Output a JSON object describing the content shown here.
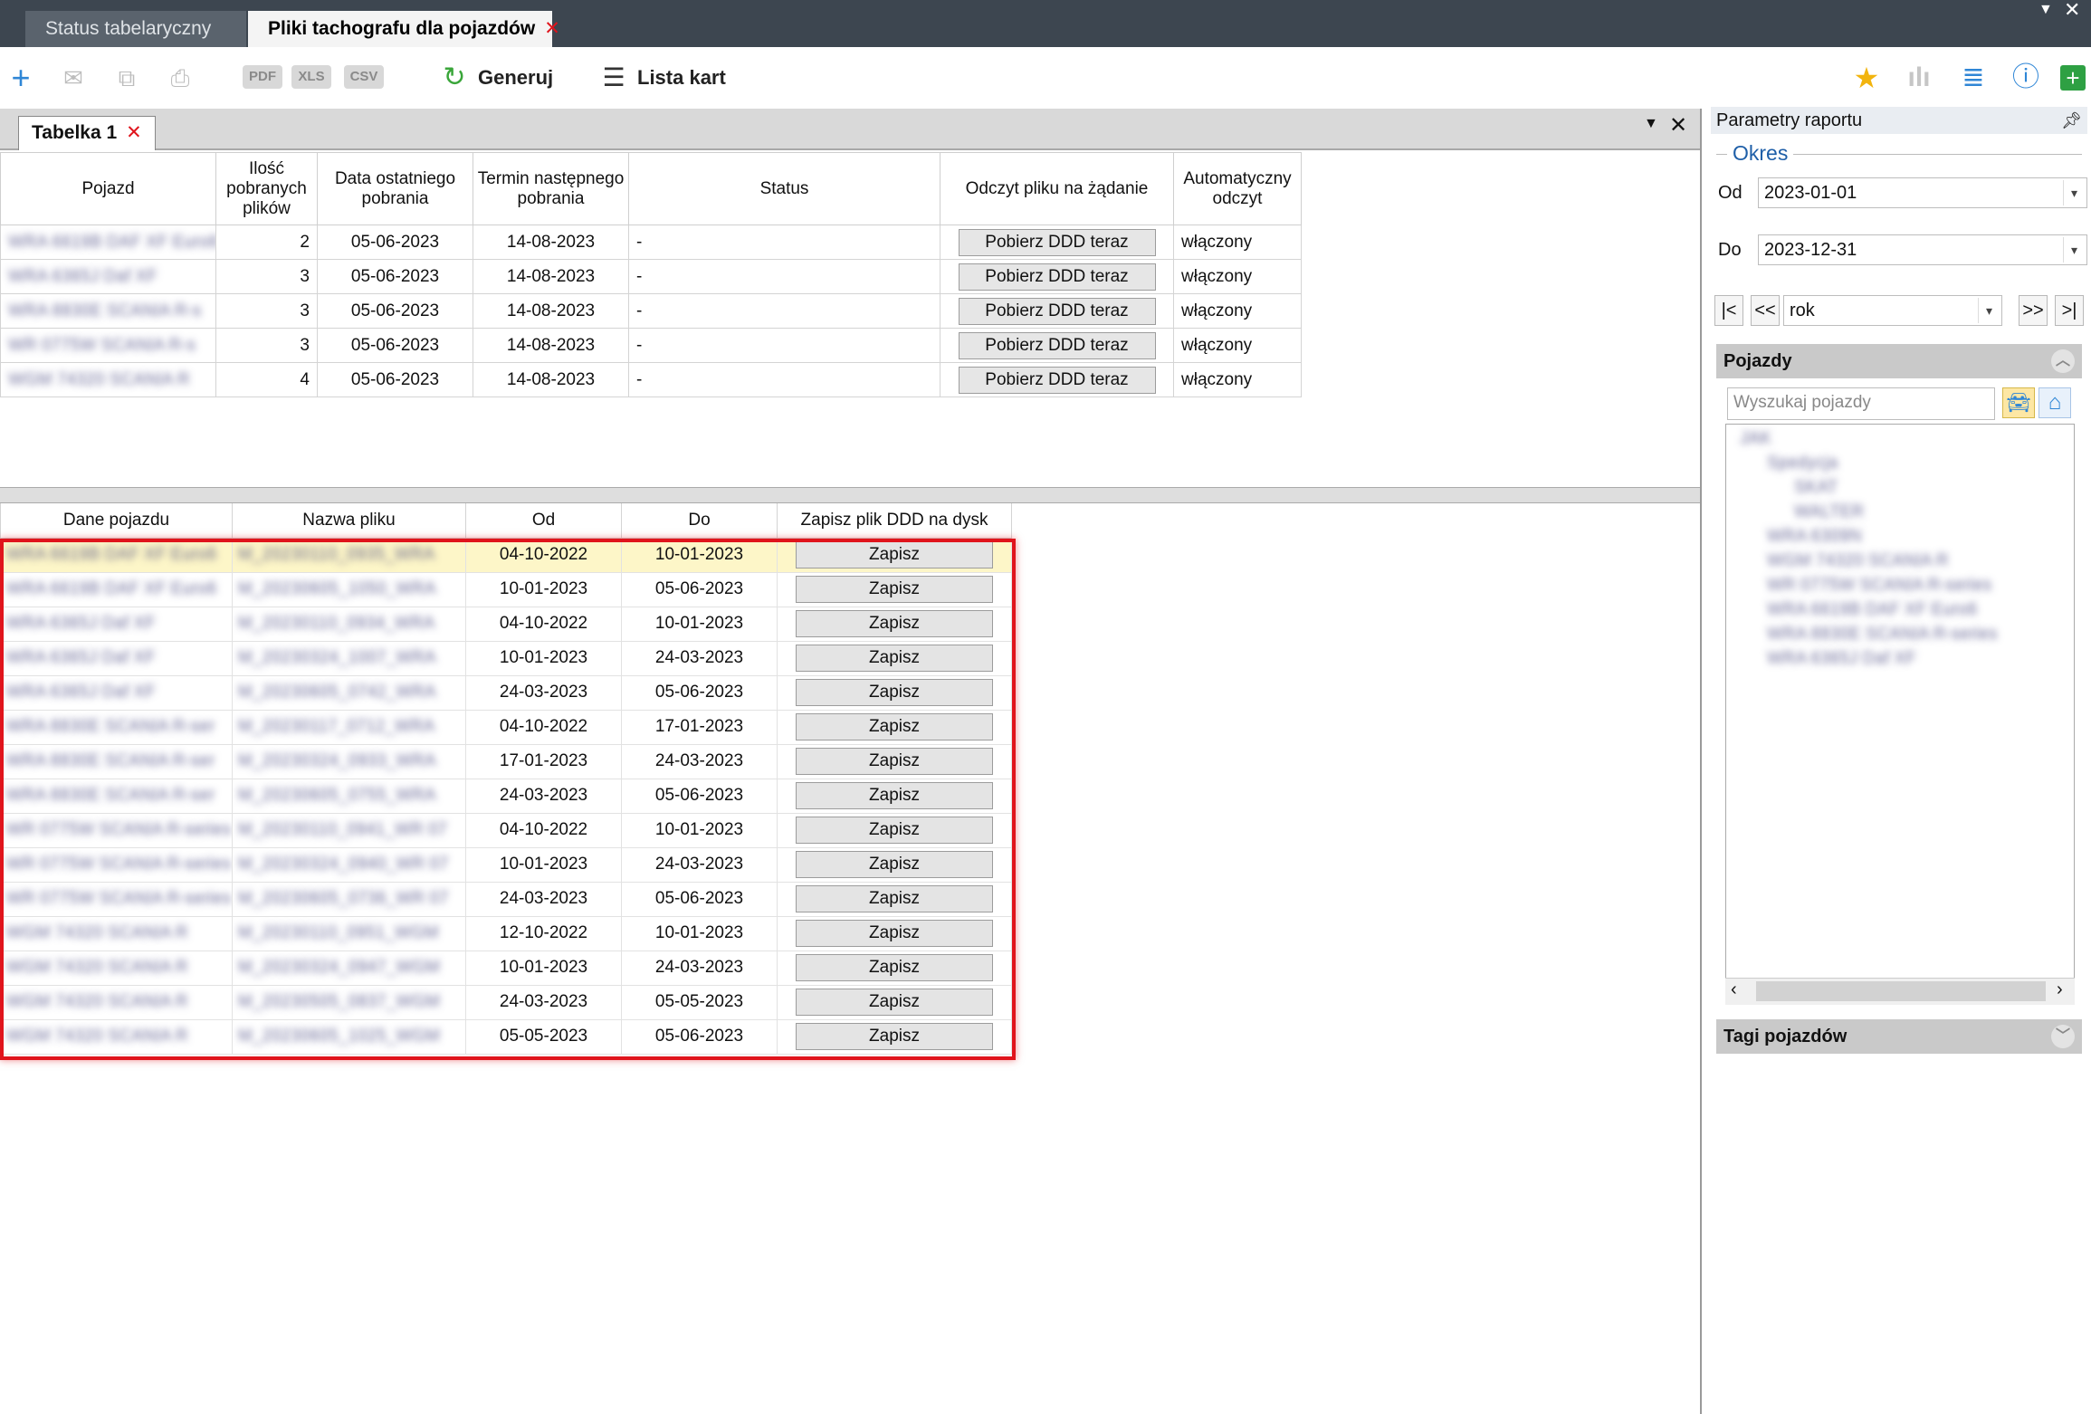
{
  "app_tabs": [
    {
      "label": "Status tabelaryczny",
      "active": false
    },
    {
      "label": "Pliki tachografu dla pojazdów",
      "active": true
    }
  ],
  "toolbar": {
    "export_formats": [
      "PDF",
      "XLS",
      "CSV"
    ],
    "generate_label": "Generuj",
    "cards_label": "Lista kart"
  },
  "subtab": {
    "label": "Tabelka 1"
  },
  "table1": {
    "headers": [
      "Pojazd",
      "Ilość pobranych plików",
      "Data ostatniego pobrania",
      "Termin następnego pobrania",
      "Status",
      "Odczyt pliku na żądanie",
      "Automatyczny odczyt"
    ],
    "rows": [
      {
        "vehicle": "WRA 6619B DAF XF Euro6",
        "count": "2",
        "last": "05-06-2023",
        "next": "14-08-2023",
        "status": "-",
        "action": "Pobierz DDD teraz",
        "auto": "włączony"
      },
      {
        "vehicle": "WRA 6365J Daf XF",
        "count": "3",
        "last": "05-06-2023",
        "next": "14-08-2023",
        "status": "-",
        "action": "Pobierz DDD teraz",
        "auto": "włączony"
      },
      {
        "vehicle": "WRA 8830E SCANIA R-s",
        "count": "3",
        "last": "05-06-2023",
        "next": "14-08-2023",
        "status": "-",
        "action": "Pobierz DDD teraz",
        "auto": "włączony"
      },
      {
        "vehicle": "WR 0775W SCANIA R-s",
        "count": "3",
        "last": "05-06-2023",
        "next": "14-08-2023",
        "status": "-",
        "action": "Pobierz DDD teraz",
        "auto": "włączony"
      },
      {
        "vehicle": "WGM 74320 SCANIA R",
        "count": "4",
        "last": "05-06-2023",
        "next": "14-08-2023",
        "status": "-",
        "action": "Pobierz DDD teraz",
        "auto": "włączony"
      }
    ]
  },
  "table2": {
    "headers": [
      "Dane pojazdu",
      "Nazwa pliku",
      "Od",
      "Do",
      "Zapisz plik DDD na dysk"
    ],
    "rows": [
      {
        "vehicle": "WRA 6619B DAF XF Euro6",
        "file": "M_20230110_0935_WRA",
        "from": "04-10-2022",
        "to": "10-01-2023",
        "action": "Zapisz"
      },
      {
        "vehicle": "WRA 6619B DAF XF Euro6",
        "file": "M_20230605_1050_WRA",
        "from": "10-01-2023",
        "to": "05-06-2023",
        "action": "Zapisz"
      },
      {
        "vehicle": "WRA 6365J Daf XF",
        "file": "M_20230110_0934_WRA",
        "from": "04-10-2022",
        "to": "10-01-2023",
        "action": "Zapisz"
      },
      {
        "vehicle": "WRA 6365J Daf XF",
        "file": "M_20230324_1007_WRA",
        "from": "10-01-2023",
        "to": "24-03-2023",
        "action": "Zapisz"
      },
      {
        "vehicle": "WRA 6365J Daf XF",
        "file": "M_20230605_0742_WRA",
        "from": "24-03-2023",
        "to": "05-06-2023",
        "action": "Zapisz"
      },
      {
        "vehicle": "WRA 8830E SCANIA R-ser",
        "file": "M_20230117_0712_WRA",
        "from": "04-10-2022",
        "to": "17-01-2023",
        "action": "Zapisz"
      },
      {
        "vehicle": "WRA 8830E SCANIA R-ser",
        "file": "M_20230324_0933_WRA",
        "from": "17-01-2023",
        "to": "24-03-2023",
        "action": "Zapisz"
      },
      {
        "vehicle": "WRA 8830E SCANIA R-ser",
        "file": "M_20230605_0755_WRA",
        "from": "24-03-2023",
        "to": "05-06-2023",
        "action": "Zapisz"
      },
      {
        "vehicle": "WR 0775W SCANIA R-series",
        "file": "M_20230110_0941_WR 07",
        "from": "04-10-2022",
        "to": "10-01-2023",
        "action": "Zapisz"
      },
      {
        "vehicle": "WR 0775W SCANIA R-series",
        "file": "M_20230324_0940_WR 07",
        "from": "10-01-2023",
        "to": "24-03-2023",
        "action": "Zapisz"
      },
      {
        "vehicle": "WR 0775W SCANIA R-series",
        "file": "M_20230605_0736_WR 07",
        "from": "24-03-2023",
        "to": "05-06-2023",
        "action": "Zapisz"
      },
      {
        "vehicle": "WGM 74320 SCANIA R",
        "file": "M_20230110_0951_WGM",
        "from": "12-10-2022",
        "to": "10-01-2023",
        "action": "Zapisz"
      },
      {
        "vehicle": "WGM 74320 SCANIA R",
        "file": "M_20230324_0947_WGM",
        "from": "10-01-2023",
        "to": "24-03-2023",
        "action": "Zapisz"
      },
      {
        "vehicle": "WGM 74320 SCANIA R",
        "file": "M_20230505_0837_WGM",
        "from": "24-03-2023",
        "to": "05-05-2023",
        "action": "Zapisz"
      },
      {
        "vehicle": "WGM 74320 SCANIA R",
        "file": "M_20230605_1025_WGM",
        "from": "05-05-2023",
        "to": "05-06-2023",
        "action": "Zapisz"
      }
    ]
  },
  "params": {
    "title": "Parametry raportu",
    "period_label": "Okres",
    "from_label": "Od",
    "from_value": "2023-01-01",
    "to_label": "Do",
    "to_value": "2023-12-31",
    "range_value": "rok",
    "vehicles_title": "Pojazdy",
    "search_placeholder": "Wyszukaj pojazdy",
    "tree": [
      "JAK",
      "Spedycja",
      "SKAT",
      "WALTER",
      "WRA 6309N",
      "WGM 74320 SCANIA R",
      "WR 0775W SCANIA R-series",
      "WRA 6619B DAF XF Euro6",
      "WRA 8830E SCANIA R-series",
      "WRA 6365J Daf XF"
    ],
    "tags_title": "Tagi pojazdów"
  },
  "colors": {
    "accent_red": "#e0141c",
    "title_bar": "#3d4650",
    "link_blue": "#1f5fa8"
  }
}
